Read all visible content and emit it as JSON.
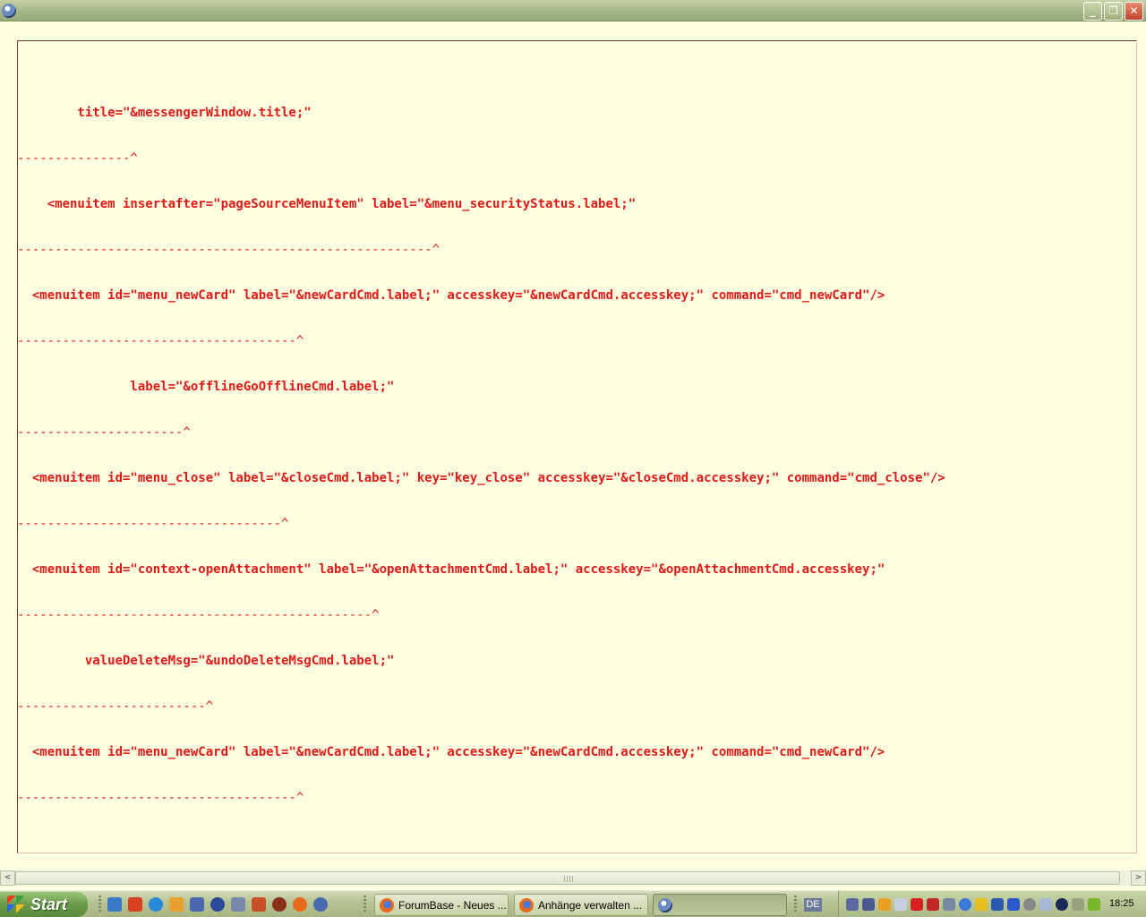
{
  "window": {
    "minimize": "_",
    "maximize": "❐",
    "close": "✕"
  },
  "errors": [
    {
      "line": "        title=\"&messengerWindow.title;\"",
      "pointer": "---------------^"
    },
    {
      "line": "    <menuitem insertafter=\"pageSourceMenuItem\" label=\"&menu_securityStatus.label;\"",
      "pointer": "-------------------------------------------------------^"
    },
    {
      "line": "  <menuitem id=\"menu_newCard\" label=\"&newCardCmd.label;\" accesskey=\"&newCardCmd.accesskey;\" command=\"cmd_newCard\"/>",
      "pointer": "-------------------------------------^"
    },
    {
      "line": "               label=\"&offlineGoOfflineCmd.label;\"",
      "pointer": "----------------------^"
    },
    {
      "line": "  <menuitem id=\"menu_close\" label=\"&closeCmd.label;\" key=\"key_close\" accesskey=\"&closeCmd.accesskey;\" command=\"cmd_close\"/>",
      "pointer": "-----------------------------------^"
    },
    {
      "line": "  <menuitem id=\"context-openAttachment\" label=\"&openAttachmentCmd.label;\" accesskey=\"&openAttachmentCmd.accesskey;\"",
      "pointer": "-----------------------------------------------^"
    },
    {
      "line": "         valueDeleteMsg=\"&undoDeleteMsgCmd.label;\"",
      "pointer": "-------------------------^"
    },
    {
      "line": "  <menuitem id=\"menu_newCard\" label=\"&newCardCmd.label;\" accesskey=\"&newCardCmd.accesskey;\" command=\"cmd_newCard\"/>",
      "pointer": "-------------------------------------^"
    }
  ],
  "scrollbar": {
    "left_arrow": "<",
    "right_arrow": ">"
  },
  "taskbar": {
    "start_label": "Start",
    "tasks": [
      {
        "label": "ForumBase - Neues ..."
      },
      {
        "label": "Anhänge verwalten ..."
      },
      {
        "label": ""
      }
    ],
    "language": "DE",
    "clock": "18:25"
  },
  "colors": {
    "error_text": "#e01818",
    "background": "#ffffe1"
  }
}
